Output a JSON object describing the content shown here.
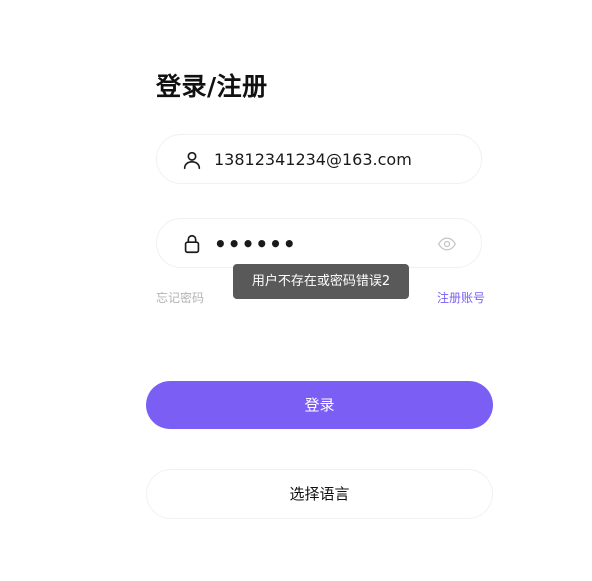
{
  "page": {
    "title": "登录/注册"
  },
  "form": {
    "username_value": "13812341234@163.com",
    "password_masked": "••••••",
    "forgot_label": "忘记密码",
    "register_label": "注册账号",
    "login_label": "登录",
    "language_label": "选择语言"
  },
  "toast": {
    "message": "用户不存在或密码错误2"
  },
  "icons": {
    "username": "user-icon",
    "password": "lock-icon",
    "toggle": "eye-icon"
  },
  "colors": {
    "accent": "#7b5ff5",
    "toast_bg": "#595959",
    "muted_text": "#b3b3b3"
  }
}
